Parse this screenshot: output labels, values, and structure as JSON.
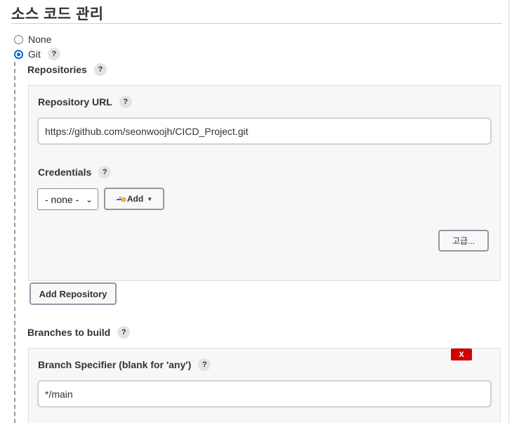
{
  "section": {
    "title": "소스 코드 관리"
  },
  "scm": {
    "options": [
      {
        "label": "None",
        "selected": false
      },
      {
        "label": "Git",
        "selected": true
      }
    ],
    "help": "?"
  },
  "repositories": {
    "label": "Repositories",
    "url_label": "Repository URL",
    "url_value": "https://github.com/seonwoojh/CICD_Project.git",
    "credentials_label": "Credentials",
    "credentials_selected": "- none -",
    "add_label": "Add",
    "advanced_label": "고급...",
    "add_repository_label": "Add Repository"
  },
  "branches": {
    "label": "Branches to build",
    "specifier_label": "Branch Specifier (blank for 'any')",
    "specifier_value": "*/main",
    "delete_label": "X"
  }
}
